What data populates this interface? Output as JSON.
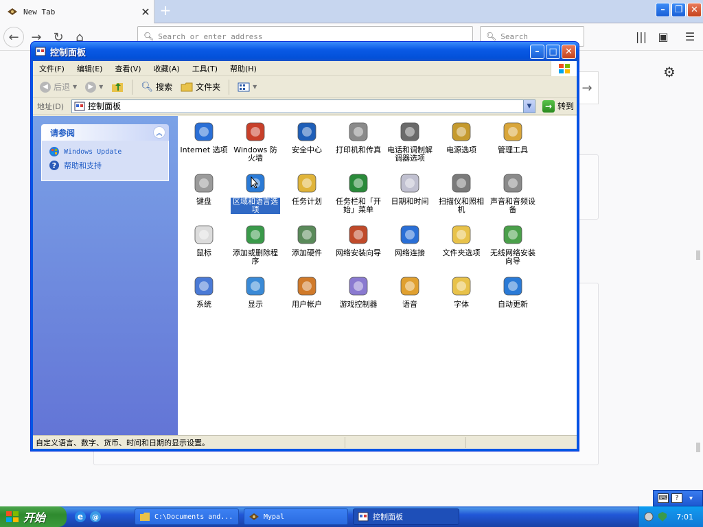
{
  "browser": {
    "tab_title": "New Tab",
    "url_placeholder": "Search or enter address",
    "search_placeholder": "Search"
  },
  "window": {
    "title": "控制面板",
    "menu": [
      "文件(F)",
      "编辑(E)",
      "查看(V)",
      "收藏(A)",
      "工具(T)",
      "帮助(H)"
    ],
    "toolbar": {
      "back": "后退",
      "search": "搜索",
      "folders": "文件夹"
    },
    "address": {
      "label": "地址(D)",
      "value": "控制面板",
      "go": "转到"
    },
    "task_pane": {
      "title": "请参阅",
      "links": [
        "Windows Update",
        "帮助和支持"
      ]
    },
    "icons": [
      {
        "label": "Internet 选项",
        "icon": "internet-options-icon",
        "color": "#2a6fd6"
      },
      {
        "label": "Windows 防火墙",
        "icon": "firewall-icon",
        "color": "#c8402a"
      },
      {
        "label": "安全中心",
        "icon": "security-center-icon",
        "color": "#1f5fb8"
      },
      {
        "label": "打印机和传真",
        "icon": "printer-icon",
        "color": "#8a8a8a"
      },
      {
        "label": "电话和调制解调器选项",
        "icon": "phone-modem-icon",
        "color": "#6a6a6a"
      },
      {
        "label": "电源选项",
        "icon": "power-options-icon",
        "color": "#c59a2e"
      },
      {
        "label": "管理工具",
        "icon": "admin-tools-icon",
        "color": "#d9a63a"
      },
      {
        "label": "键盘",
        "icon": "keyboard-icon",
        "color": "#9a9a9a"
      },
      {
        "label": "区域和语言选项",
        "icon": "regional-language-icon",
        "color": "#2a7ad6"
      },
      {
        "label": "任务计划",
        "icon": "scheduled-tasks-icon",
        "color": "#e0b43a"
      },
      {
        "label": "任务栏和「开始」菜单",
        "icon": "taskbar-start-icon",
        "color": "#2a8a3a"
      },
      {
        "label": "日期和时间",
        "icon": "date-time-icon",
        "color": "#c0c0d0"
      },
      {
        "label": "扫描仪和照相机",
        "icon": "scanner-camera-icon",
        "color": "#7a7a7a"
      },
      {
        "label": "声音和音频设备",
        "icon": "sound-audio-icon",
        "color": "#8a8a8a"
      },
      {
        "label": "鼠标",
        "icon": "mouse-icon",
        "color": "#dcdcdc"
      },
      {
        "label": "添加或删除程序",
        "icon": "add-remove-programs-icon",
        "color": "#3a9a4a"
      },
      {
        "label": "添加硬件",
        "icon": "add-hardware-icon",
        "color": "#5a8a5a"
      },
      {
        "label": "网络安装向导",
        "icon": "network-setup-wizard-icon",
        "color": "#c04a2a"
      },
      {
        "label": "网络连接",
        "icon": "network-connections-icon",
        "color": "#2a6fd6"
      },
      {
        "label": "文件夹选项",
        "icon": "folder-options-icon",
        "color": "#e8c24a"
      },
      {
        "label": "无线网络安装向导",
        "icon": "wireless-wizard-icon",
        "color": "#4aa04a"
      },
      {
        "label": "系统",
        "icon": "system-icon",
        "color": "#4a7ad6"
      },
      {
        "label": "显示",
        "icon": "display-icon",
        "color": "#3a8ad6"
      },
      {
        "label": "用户帐户",
        "icon": "user-accounts-icon",
        "color": "#d07a2a"
      },
      {
        "label": "游戏控制器",
        "icon": "game-controller-icon",
        "color": "#8a7ad0"
      },
      {
        "label": "语音",
        "icon": "speech-icon",
        "color": "#e0a030"
      },
      {
        "label": "字体",
        "icon": "fonts-icon",
        "color": "#e8c24a"
      },
      {
        "label": "自动更新",
        "icon": "automatic-updates-icon",
        "color": "#2a7ad6"
      }
    ],
    "status": "自定义语言、数字、货币、时间和日期的显示设置。"
  },
  "taskbar": {
    "start": "开始",
    "tasks": [
      "C:\\Documents and...",
      "Mypal",
      "控制面板"
    ],
    "clock": "7:01"
  }
}
